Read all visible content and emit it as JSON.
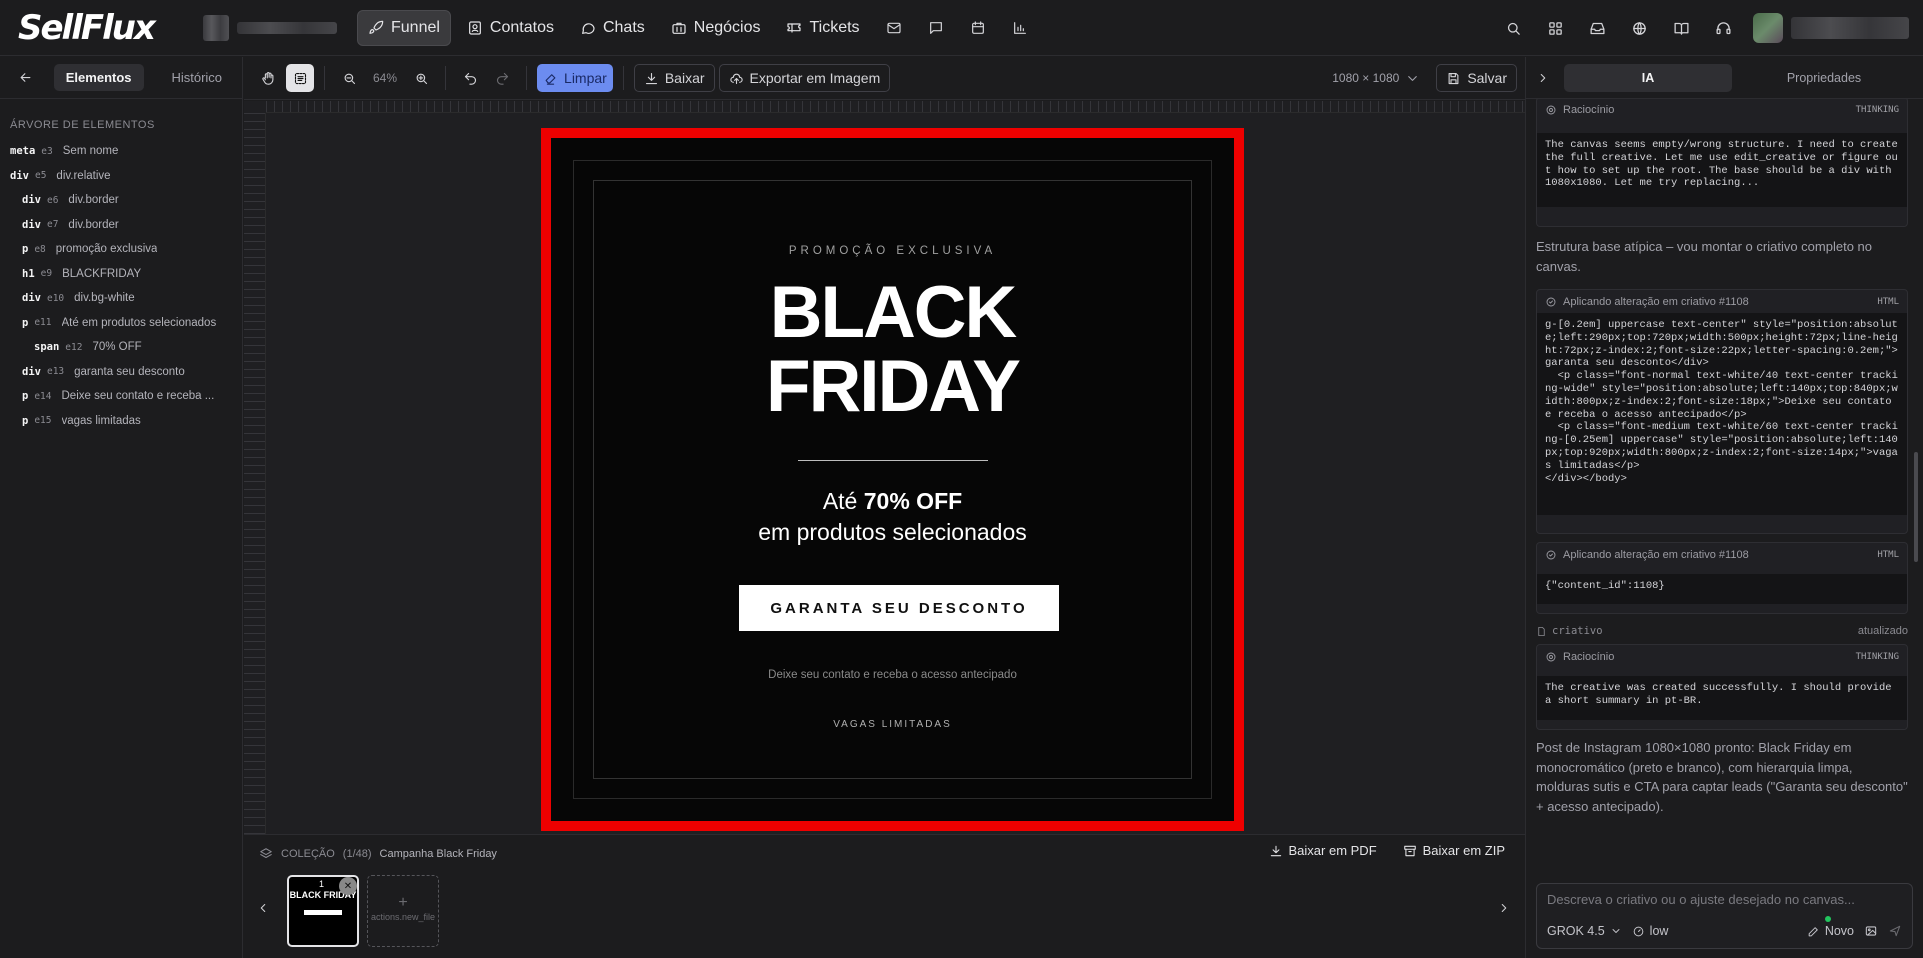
{
  "app": {
    "logo": "SellFlux"
  },
  "nav": {
    "items": [
      {
        "label": "Funnel",
        "icon": "rocket-icon",
        "active": true
      },
      {
        "label": "Contatos",
        "icon": "contacts-icon"
      },
      {
        "label": "Chats",
        "icon": "chat-bubble-icon"
      },
      {
        "label": "Negócios",
        "icon": "briefcase-icon"
      },
      {
        "label": "Tickets",
        "icon": "ticket-icon"
      }
    ],
    "extra_icons": [
      "mail-icon",
      "message-square-icon",
      "calendar-icon",
      "bar-chart-icon"
    ]
  },
  "top_right_icons": [
    "search-icon",
    "apps-grid-icon",
    "inbox-icon",
    "globe-icon",
    "book-icon",
    "headset-icon"
  ],
  "left_panel": {
    "tabs": [
      "Elementos",
      "Histórico"
    ],
    "active_tab": "Elementos",
    "tree_title": "ÁRVORE DE ELEMENTOS",
    "tree": [
      {
        "tag": "meta",
        "id": "e3",
        "label": "Sem nome",
        "depth": 0
      },
      {
        "tag": "div",
        "id": "e5",
        "label": "div.relative",
        "depth": 0
      },
      {
        "tag": "div",
        "id": "e6",
        "label": "div.border",
        "depth": 1
      },
      {
        "tag": "div",
        "id": "e7",
        "label": "div.border",
        "depth": 1
      },
      {
        "tag": "p",
        "id": "e8",
        "label": "promoção exclusiva",
        "depth": 1
      },
      {
        "tag": "h1",
        "id": "e9",
        "label": "BLACKFRIDAY",
        "depth": 1
      },
      {
        "tag": "div",
        "id": "e10",
        "label": "div.bg-white",
        "depth": 1
      },
      {
        "tag": "p",
        "id": "e11",
        "label": "Até em produtos selecionados",
        "depth": 1
      },
      {
        "tag": "span",
        "id": "e12",
        "label": "70% OFF",
        "depth": 2
      },
      {
        "tag": "div",
        "id": "e13",
        "label": "garanta seu desconto",
        "depth": 1
      },
      {
        "tag": "p",
        "id": "e14",
        "label": "Deixe seu contato e receba ...",
        "depth": 1
      },
      {
        "tag": "p",
        "id": "e15",
        "label": "vagas limitadas",
        "depth": 1
      }
    ]
  },
  "toolbar": {
    "zoom": "64%",
    "limpar": "Limpar",
    "baixar": "Baixar",
    "exportar": "Exportar em Imagem",
    "size": "1080 × 1080",
    "salvar": "Salvar"
  },
  "creative": {
    "promo": "PROMOÇÃO EXCLUSIVA",
    "title_line1": "BLACK",
    "title_line2": "FRIDAY",
    "ate": "Até",
    "off": "70% OFF",
    "selecionados": "em produtos selecionados",
    "cta": "GARANTA SEU DESCONTO",
    "lead": "Deixe seu contato e receba o acesso antecipado",
    "vagas": "VAGAS LIMITADAS"
  },
  "collection": {
    "label": "COLEÇÃO",
    "count": "(1/48)",
    "name": "Campanha Black Friday",
    "pdf": "Baixar em PDF",
    "zip": "Baixar em ZIP",
    "thumb_num": "1",
    "thumb_title": "BLACK FRIDAY",
    "new_file": "actions.new_file"
  },
  "right_panel": {
    "tabs": [
      "IA",
      "Propriedades"
    ],
    "active_tab": "IA",
    "card1": {
      "title": "Raciocínio",
      "tag": "THINKING",
      "body": "The canvas seems empty/wrong structure. I need to create the full creative. Let me use edit_creative or figure out how to set up the root. The base should be a div with 1080x1080. Let me try replacing..."
    },
    "para1": "Estrutura base atípica – vou montar o criativo completo no canvas.",
    "card2": {
      "title": "Aplicando alteração em criativo #1108",
      "tag": "HTML",
      "body": "g-[0.2em] uppercase text-center\" style=\"position:absolute;left:290px;top:720px;width:500px;height:72px;line-height:72px;z-index:2;font-size:22px;letter-spacing:0.2em;\">garanta seu desconto</div>\n  <p class=\"font-normal text-white/40 text-center tracking-wide\" style=\"position:absolute;left:140px;top:840px;width:800px;z-index:2;font-size:18px;\">Deixe seu contato e receba o acesso antecipado</p>\n  <p class=\"font-medium text-white/60 text-center tracking-[0.25em] uppercase\" style=\"position:absolute;left:140px;top:920px;width:800px;z-index:2;font-size:14px;\">vagas limitadas</p>\n</div></body>"
    },
    "card3": {
      "title": "Aplicando alteração em criativo #1108",
      "tag": "HTML",
      "body": "{\"content_id\":1108}"
    },
    "criativo": {
      "label": "criativo",
      "status": "atualizado"
    },
    "card4": {
      "title": "Raciocínio",
      "tag": "THINKING",
      "body": "The creative was created successfully. I should provide a short summary in pt-BR."
    },
    "para2": "Post de Instagram 1080×1080 pronto: Black Friday em monocromático (preto e branco), com hierarquia limpa, molduras sutis e CTA para captar leads (\"Garanta seu desconto\" + acesso antecipado).",
    "input_placeholder": "Descreva o criativo ou o ajuste desejado no canvas...",
    "model": "GROK 4.5",
    "effort": "low",
    "novo": "Novo"
  }
}
